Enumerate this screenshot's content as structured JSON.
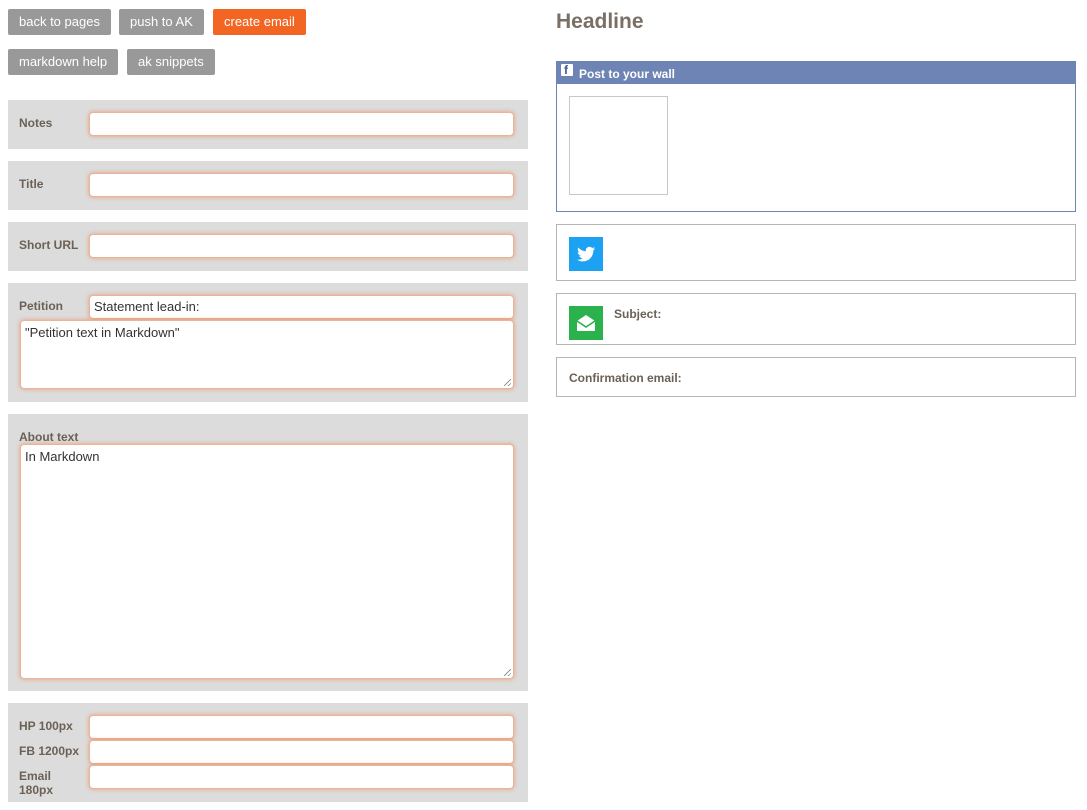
{
  "toolbar": {
    "back_label": "back to pages",
    "push_label": "push to AK",
    "create_email_label": "create email",
    "markdown_help_label": "markdown help",
    "ak_snippets_label": "ak snippets"
  },
  "form": {
    "notes_label": "Notes",
    "title_label": "Title",
    "short_url_label": "Short URL",
    "petition_label": "Petition",
    "petition_leadin_value": "Statement lead-in:",
    "petition_text_value": "\"Petition text in Markdown\"",
    "about_label": "About text",
    "about_value": "In Markdown",
    "hp_label": "HP 100px",
    "fb_label": "FB 1200px",
    "email_label_line1": "Email",
    "email_label_line2": "180px"
  },
  "preview": {
    "headline": "Headline",
    "facebook_bar_label": "Post to your wall",
    "email_subject_label": "Subject:",
    "confirmation_label": "Confirmation email:"
  },
  "colors": {
    "accent": "#f26522",
    "button_gray": "#999999",
    "facebook_blue": "#6d84b4",
    "twitter_blue": "#1da1f2",
    "email_green": "#2bb24c"
  }
}
